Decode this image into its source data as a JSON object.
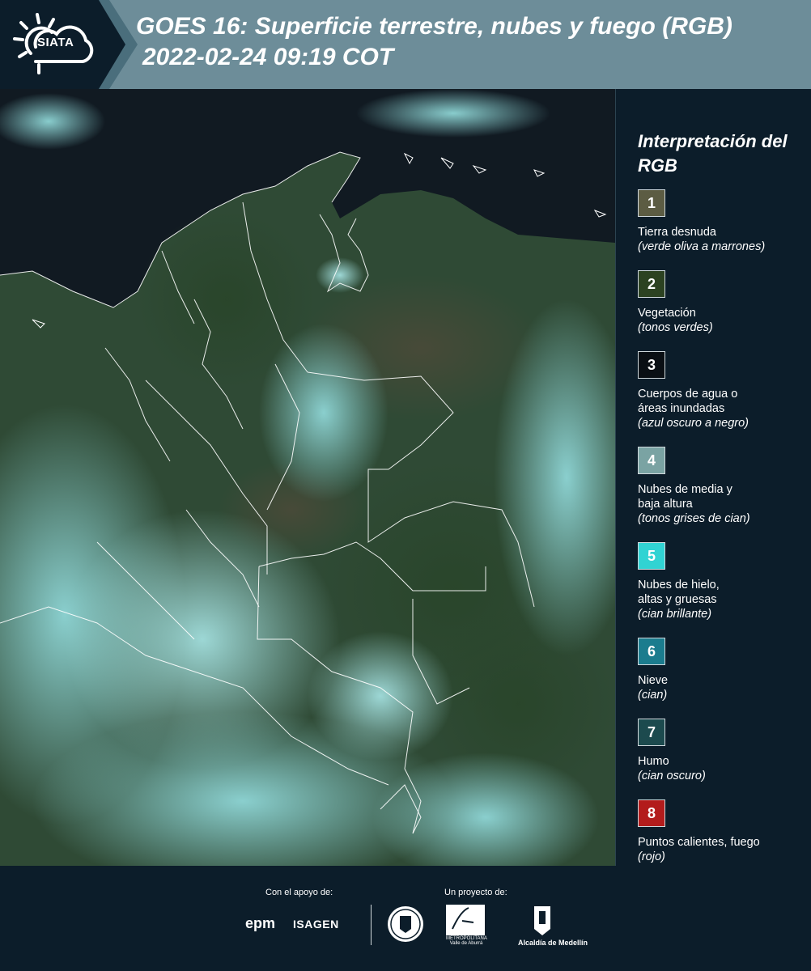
{
  "header": {
    "title": "GOES 16: Superficie terrestre, nubes y fuego (RGB)",
    "subtitle": "2022-02-24 09:19 COT",
    "logo_text": "SIATA"
  },
  "legend": {
    "title": "Interpretación del RGB",
    "items": [
      {
        "num": "1",
        "label": "Tierra desnuda",
        "desc": "(verde oliva a marrones)",
        "color": "#5c5c43"
      },
      {
        "num": "2",
        "label": "Vegetación",
        "desc": "(tonos verdes)",
        "color": "#2c4221"
      },
      {
        "num": "3",
        "label": "Cuerpos de agua o\náreas inundadas",
        "desc": "(azul oscuro a negro)",
        "color": "#0a0f14"
      },
      {
        "num": "4",
        "label": "Nubes de media y\nbaja altura",
        "desc": "(tonos grises de cian)",
        "color": "#7aa3a3"
      },
      {
        "num": "5",
        "label": "Nubes de hielo,\naltas y gruesas",
        "desc": "(cian brillante)",
        "color": "#31d3d3"
      },
      {
        "num": "6",
        "label": "Nieve",
        "desc": "(cian)",
        "color": "#1b7c8e"
      },
      {
        "num": "7",
        "label": "Humo",
        "desc": "(cian oscuro)",
        "color": "#1c4a4e"
      },
      {
        "num": "8",
        "label": "Puntos calientes, fuego",
        "desc": "(rojo)",
        "color": "#b31c1c"
      }
    ]
  },
  "footer": {
    "support_label": "Con el apoyo de:",
    "project_label": "Un proyecto de:",
    "sponsor_1": "epm",
    "sponsor_2": "ISAGEN",
    "partner_1_text": "METROPOLITANA Valle de Aburrá",
    "partner_1_logo": "Área",
    "partner_2_text": "Alcaldía de Medellín"
  },
  "icons": {
    "logo": "sun-cloud-icon",
    "seal": "university-seal-icon",
    "amva": "amva-logo-icon",
    "alcaldia": "alcaldia-shield-icon"
  }
}
